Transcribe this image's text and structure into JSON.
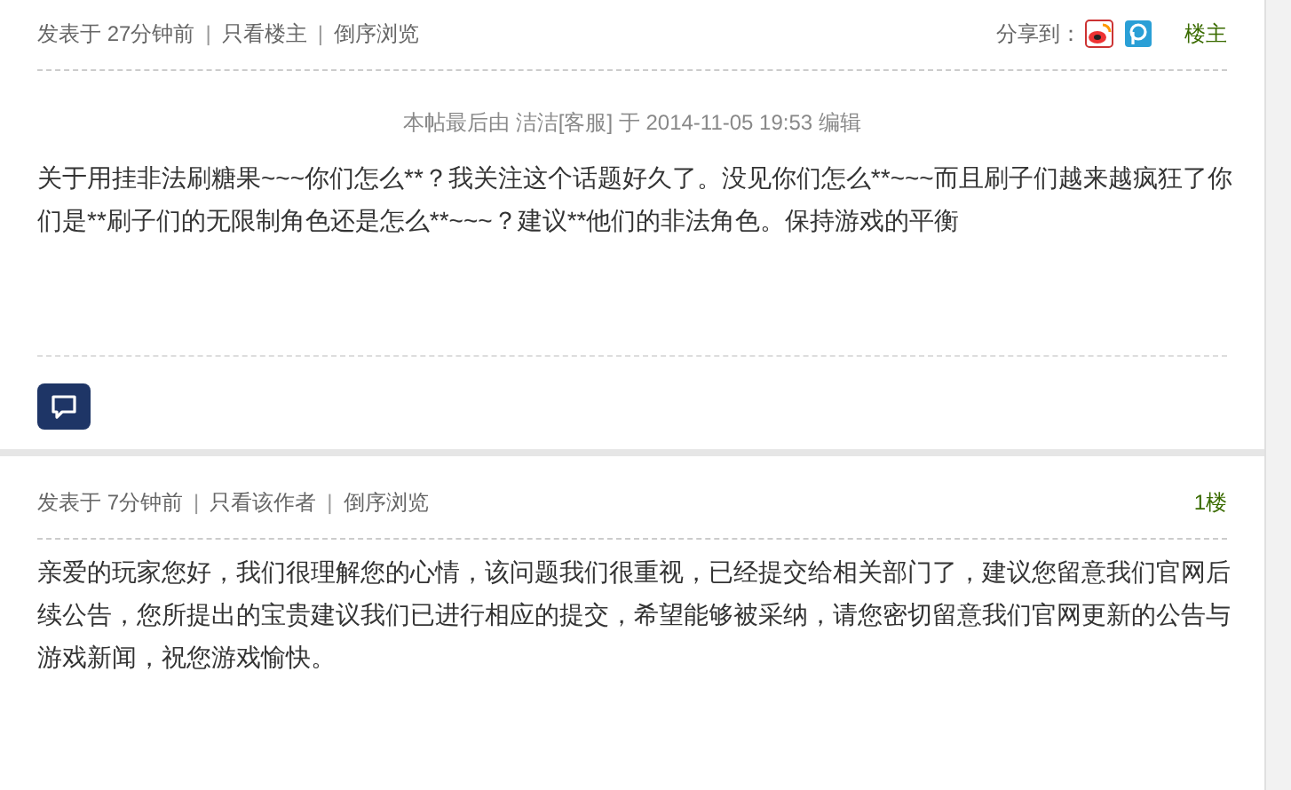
{
  "posts": [
    {
      "meta": [
        "发表于 27分钟前",
        "只看楼主",
        "倒序浏览"
      ],
      "separator": "|",
      "share": {
        "label": "分享到："
      },
      "floor": "楼主",
      "edit_note": "本帖最后由 洁洁[客服] 于 2014-11-05 19:53 编辑",
      "body": "关于用挂非法刷糖果~~~你们怎么**？我关注这个话题好久了。没见你们怎么**~~~而且刷子们越来越疯狂了你们是**刷子们的无限制角色还是怎么**~~~？建议**他们的非法角色。保持游戏的平衡",
      "reply_button": true
    },
    {
      "meta": [
        "发表于 7分钟前",
        "只看该作者",
        "倒序浏览"
      ],
      "separator": "|",
      "floor": "1楼",
      "body": "亲爱的玩家您好，我们很理解您的心情，该问题我们很重视，已经提交给相关部门了，建议您留意我们官网后续公告，您所提出的宝贵建议我们已进行相应的提交，希望能够被采纳，请您密切留意我们官网更新的公告与游戏新闻，祝您游戏愉快。",
      "reply_button": false
    }
  ]
}
